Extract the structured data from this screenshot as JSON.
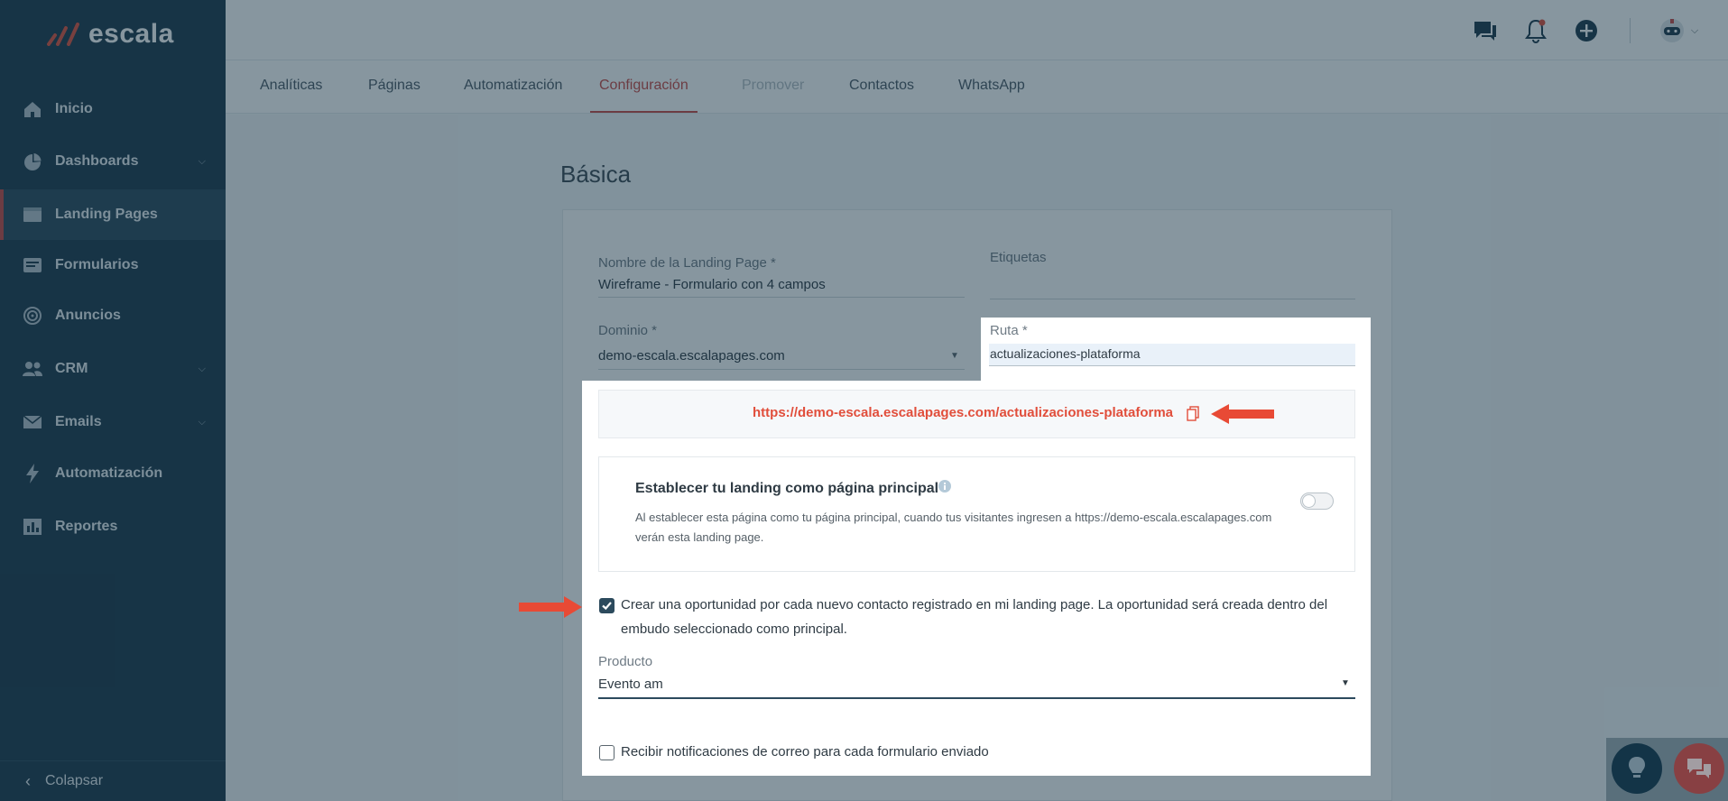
{
  "brand": {
    "logo_text": "escala",
    "accent": "#c94b46"
  },
  "sidebar": {
    "items": [
      {
        "label": "Inicio",
        "icon": "home-icon"
      },
      {
        "label": "Dashboards",
        "icon": "pie-chart-icon",
        "has_submenu": true
      },
      {
        "label": "Landing Pages",
        "icon": "landing-page-icon",
        "active": true
      },
      {
        "label": "Formularios",
        "icon": "form-icon"
      },
      {
        "label": "Anuncios",
        "icon": "target-icon"
      },
      {
        "label": "CRM",
        "icon": "users-icon",
        "has_submenu": true
      },
      {
        "label": "Emails",
        "icon": "mail-icon",
        "has_submenu": true
      },
      {
        "label": "Automatización",
        "icon": "lightning-icon"
      },
      {
        "label": "Reportes",
        "icon": "report-icon"
      }
    ],
    "collapse_label": "Colapsar"
  },
  "topbar": {
    "icons": [
      "chat-icon",
      "bell-icon",
      "plus-circle-icon",
      "avatar-bot-icon"
    ]
  },
  "tabs": [
    {
      "label": "Analíticas"
    },
    {
      "label": "Páginas"
    },
    {
      "label": "Automatización"
    },
    {
      "label": "Configuración",
      "active": true
    },
    {
      "label": "Promover",
      "disabled": true
    },
    {
      "label": "Contactos"
    },
    {
      "label": "WhatsApp"
    }
  ],
  "form": {
    "section_title": "Básica",
    "name": {
      "label": "Nombre de la Landing Page *",
      "value": "Wireframe - Formulario con 4 campos"
    },
    "tags": {
      "label": "Etiquetas",
      "value": ""
    },
    "domain": {
      "label": "Dominio *",
      "value": "demo-escala.escalapages.com"
    },
    "route": {
      "label": "Ruta *",
      "value": "actualizaciones-plataforma"
    },
    "url": "https://demo-escala.escalapages.com/actualizaciones-plataforma",
    "homepage": {
      "title": "Establecer tu landing como página principal",
      "desc_line1": "Al establecer esta página como tu página principal, cuando tus visitantes ingresen a https://demo-escala.escalapages.com",
      "desc_line2": "verán esta landing page.",
      "enabled": false
    },
    "opportunity": {
      "checked": true,
      "line1": "Crear una oportunidad por cada nuevo contacto registrado en mi landing page. La oportunidad será creada dentro del",
      "line2": "embudo seleccionado como principal."
    },
    "product": {
      "label": "Producto",
      "value": "Evento am"
    },
    "notify": {
      "checked": false,
      "label": "Recibir notificaciones de correo para cada formulario enviado"
    }
  },
  "colors": {
    "sidebar": "#1f3a4c",
    "link": "#e14e3b",
    "annotation_arrow": "#e84a35"
  }
}
